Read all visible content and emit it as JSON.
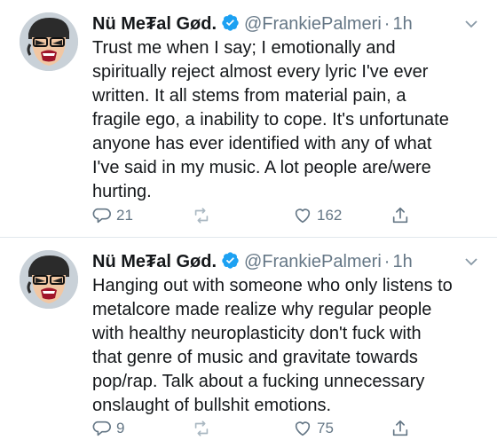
{
  "tweets": [
    {
      "author": {
        "display_name": "Nü Me₮al Gød.",
        "handle": "@FrankiePalmeri",
        "separator": "·",
        "time": "1h",
        "verified": true
      },
      "text": "Trust me when I say; I emotionally and\nspiritually reject almost every lyric I've ever\nwritten. It all stems from material pain, a\nfragile ego, a inability to cope. It's unfortunate\nanyone has ever identified with any of what\nI've said in my music. A lot people are/were\nhurting.",
      "actions": {
        "replies": "21",
        "retweets": "",
        "likes": "162"
      }
    },
    {
      "author": {
        "display_name": "Nü Me₮al Gød.",
        "handle": "@FrankiePalmeri",
        "separator": "·",
        "time": "1h",
        "verified": true
      },
      "text": "Hanging out with someone who only listens to\nmetalcore made realize why regular people\nwith healthy neuroplasticity don't fuck with\nthat genre of music and gravitate towards\npop/rap. Talk about a fucking unnecessary\nonslaught of bullshit emotions.",
      "actions": {
        "replies": "9",
        "retweets": "",
        "likes": "75"
      }
    }
  ],
  "colors": {
    "text": "#14171a",
    "secondary": "#657786",
    "verified": "#1da1f2",
    "divider": "#e1e8ed"
  },
  "icons": [
    "avatar-cartoon",
    "verified-badge-icon",
    "chevron-down-icon",
    "reply-icon",
    "retweet-icon",
    "like-icon",
    "share-icon"
  ]
}
